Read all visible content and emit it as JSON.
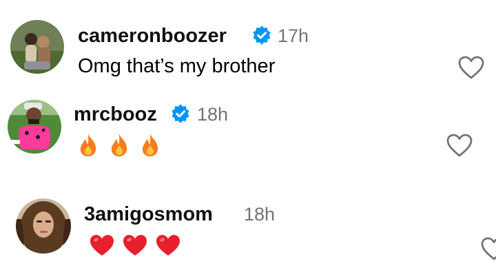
{
  "comments": [
    {
      "username": "cameronboozer",
      "verified": true,
      "time": "17h",
      "text": "Omg that’s my brother",
      "reactions": [],
      "like_icon": "heart-outline-icon"
    },
    {
      "username": "mrcbooz",
      "verified": true,
      "time": "18h",
      "text": "",
      "reactions": [
        "fire-emoji",
        "fire-emoji",
        "fire-emoji"
      ],
      "like_icon": "heart-outline-icon"
    },
    {
      "username": "3amigosmom",
      "verified": false,
      "time": "18h",
      "text": "",
      "reactions": [
        "red-heart-emoji",
        "red-heart-emoji",
        "red-heart-emoji"
      ],
      "like_icon": "heart-outline-icon"
    }
  ],
  "colors": {
    "verified_badge": "#0095f6",
    "timestamp": "#737373",
    "heart_emoji": "#e8202e",
    "fire_emoji_outer": "#f57c1f",
    "fire_emoji_inner": "#ffc53d",
    "like_icon_stroke": "#737373"
  }
}
